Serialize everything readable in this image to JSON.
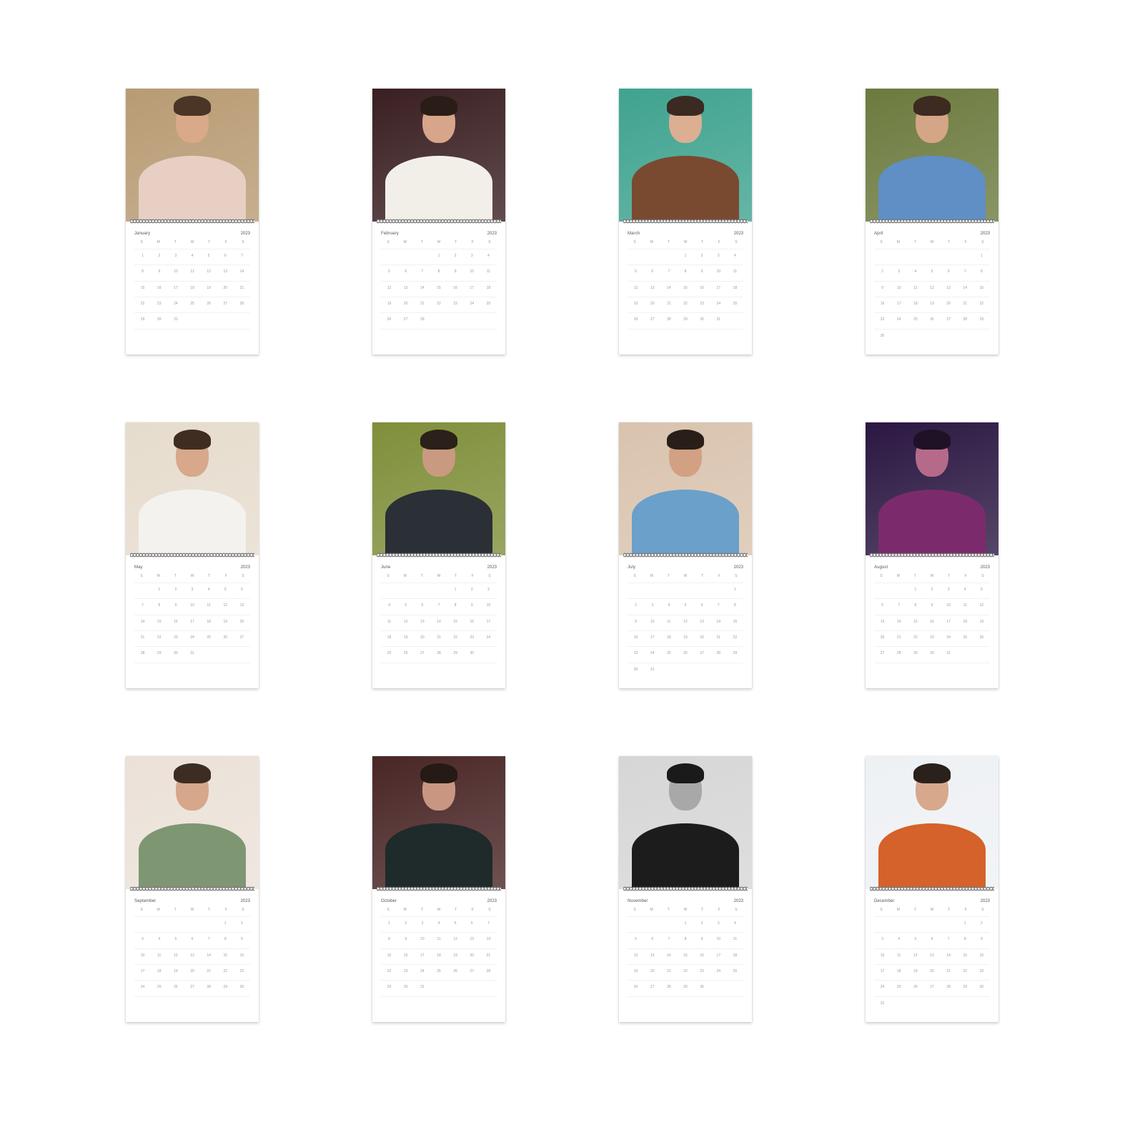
{
  "months": [
    {
      "name": "January",
      "year": "2023",
      "lead": 0,
      "days": 31,
      "palette": {
        "bg": "#b89b73",
        "skin": "#d9a98a",
        "hair": "#4a3526",
        "top": "#e8cfc4"
      }
    },
    {
      "name": "February",
      "year": "2023",
      "lead": 3,
      "days": 28,
      "palette": {
        "bg": "#3a1f22",
        "skin": "#d6a58a",
        "hair": "#2a1c16",
        "top": "#f2efe9"
      }
    },
    {
      "name": "March",
      "year": "2023",
      "lead": 3,
      "days": 31,
      "palette": {
        "bg": "#3fa38f",
        "skin": "#dcae92",
        "hair": "#3b2a21",
        "top": "#7a4a30"
      }
    },
    {
      "name": "April",
      "year": "2023",
      "lead": 6,
      "days": 30,
      "palette": {
        "bg": "#6c7a3e",
        "skin": "#d4a586",
        "hair": "#3d2a20",
        "top": "#5f8fc4"
      }
    },
    {
      "name": "May",
      "year": "2023",
      "lead": 1,
      "days": 31,
      "palette": {
        "bg": "#e6dccd",
        "skin": "#d7a88a",
        "hair": "#3f2d22",
        "top": "#f4f2ee"
      }
    },
    {
      "name": "June",
      "year": "2023",
      "lead": 4,
      "days": 30,
      "palette": {
        "bg": "#7f8f3a",
        "skin": "#c99a7f",
        "hair": "#2c201a",
        "top": "#2b2f36"
      }
    },
    {
      "name": "July",
      "year": "2023",
      "lead": 6,
      "days": 31,
      "palette": {
        "bg": "#d9c3ae",
        "skin": "#d2a183",
        "hair": "#2a1e18",
        "top": "#6aa0c9"
      }
    },
    {
      "name": "August",
      "year": "2023",
      "lead": 2,
      "days": 31,
      "palette": {
        "bg": "#2b1742",
        "skin": "#b56a8a",
        "hair": "#1f1226",
        "top": "#7b2b6c"
      }
    },
    {
      "name": "September",
      "year": "2023",
      "lead": 5,
      "days": 30,
      "palette": {
        "bg": "#ebe1d8",
        "skin": "#d6a78a",
        "hair": "#3d2c22",
        "top": "#7f9672"
      }
    },
    {
      "name": "October",
      "year": "2023",
      "lead": 0,
      "days": 31,
      "palette": {
        "bg": "#4a2626",
        "skin": "#c99781",
        "hair": "#251a15",
        "top": "#1f2a2a"
      }
    },
    {
      "name": "November",
      "year": "2023",
      "lead": 3,
      "days": 30,
      "palette": {
        "bg": "#d6d6d6",
        "skin": "#a8a8a8",
        "hair": "#1a1a1a",
        "top": "#1c1c1c"
      }
    },
    {
      "name": "December",
      "year": "2023",
      "lead": 5,
      "days": 31,
      "palette": {
        "bg": "#eef1f4",
        "skin": "#d8a88c",
        "hair": "#2b211c",
        "top": "#d4622a"
      }
    }
  ]
}
